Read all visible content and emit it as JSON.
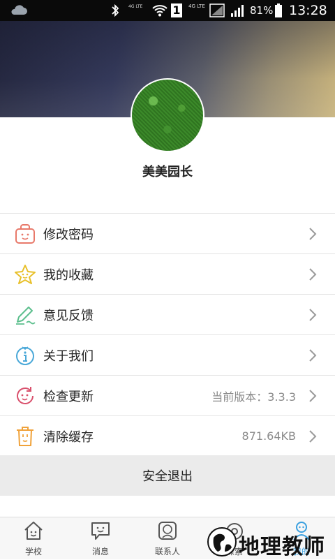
{
  "status_bar": {
    "network_1": "4G LTE",
    "sim_slot": "1",
    "network_2": "4G LTE",
    "battery": "81%",
    "time": "13:28"
  },
  "profile": {
    "name": "美美园长"
  },
  "menu": [
    {
      "label": "修改密码",
      "value": "",
      "icon": "lock-icon",
      "color": "#e8796a"
    },
    {
      "label": "我的收藏",
      "value": "",
      "icon": "star-icon",
      "color": "#e8c02a"
    },
    {
      "label": "意见反馈",
      "value": "",
      "icon": "pencil-icon",
      "color": "#5cbf8d"
    },
    {
      "label": "关于我们",
      "value": "",
      "icon": "info-icon",
      "color": "#4aa8d8"
    },
    {
      "label": "检查更新",
      "value": "当前版本：3.3.3",
      "icon": "refresh-icon",
      "color": "#d9506c"
    },
    {
      "label": "清除缓存",
      "value": "871.64KB",
      "icon": "trash-icon",
      "color": "#f0a23a"
    }
  ],
  "logout_label": "安全退出",
  "tabs": [
    {
      "label": "学校",
      "icon": "school-icon"
    },
    {
      "label": "消息",
      "icon": "message-icon"
    },
    {
      "label": "联系人",
      "icon": "contacts-icon"
    },
    {
      "label": "探索",
      "icon": "explore-icon"
    },
    {
      "label": "我的",
      "icon": "profile-icon",
      "active": true
    }
  ],
  "watermark": {
    "text": "地理教师"
  },
  "colors": {
    "accent": "#3aa0e0",
    "divider": "#e4e4e4",
    "logout_bg": "#ebebeb"
  }
}
